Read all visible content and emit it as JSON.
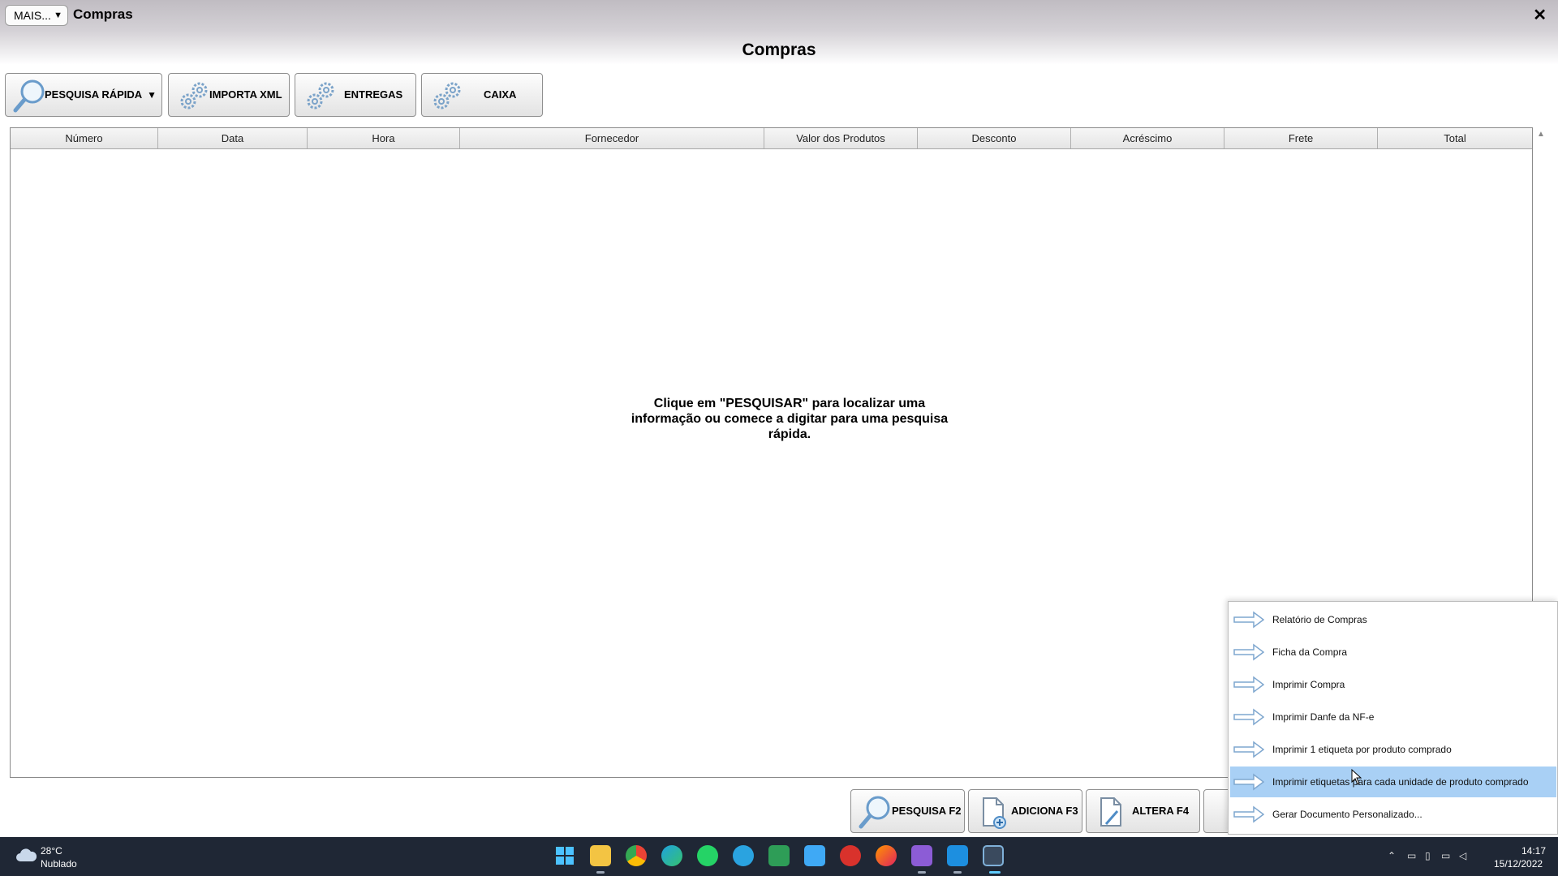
{
  "window": {
    "mais_label": "MAIS...",
    "title": "Compras",
    "close_glyph": "✕"
  },
  "page": {
    "title": "Compras"
  },
  "toolbar": {
    "quick_search": "PESQUISA RÁPIDA",
    "import_xml": "IMPORTA XML",
    "deliveries": "ENTREGAS",
    "cash": "CAIXA"
  },
  "table": {
    "columns": [
      "Número",
      "Data",
      "Hora",
      "Fornecedor",
      "Valor dos Produtos",
      "Desconto",
      "Acréscimo",
      "Frete",
      "Total"
    ],
    "rows": [],
    "empty_message": "Clique em \"PESQUISAR\" para localizar uma informação ou comece a digitar para uma pesquisa rápida."
  },
  "bottom_buttons": {
    "search": "PESQUISA F2",
    "add": "ADICIONA F3",
    "edit": "ALTERA F4"
  },
  "print_menu": {
    "items": [
      "Relatório de Compras",
      "Ficha da Compra",
      "Imprimir Compra",
      "Imprimir Danfe da NF-e",
      "Imprimir 1 etiqueta por produto comprado",
      "Imprimir etiquetas para cada unidade de produto comprado",
      "Gerar Documento Personalizado..."
    ],
    "selected_index": 5,
    "highlight_color": "#a9d0f5"
  },
  "taskbar": {
    "weather": {
      "temp": "28°C",
      "desc": "Nublado",
      "icon": "cloud-icon"
    },
    "apps": [
      "windows-start-icon",
      "file-explorer-icon",
      "chrome-icon",
      "edge-icon",
      "whatsapp-icon",
      "telegram-icon",
      "spreadsheet-icon",
      "app-icon",
      "antivirus-icon",
      "firefox-icon",
      "video-editor-icon",
      "mail-icon",
      "erp-app-icon"
    ],
    "clock": {
      "time": "14:17",
      "date": "15/12/2022"
    }
  },
  "colors": {
    "titlebar": "#c0bcc2",
    "taskbar": "#1f2735",
    "accent": "#2a7fd4"
  }
}
